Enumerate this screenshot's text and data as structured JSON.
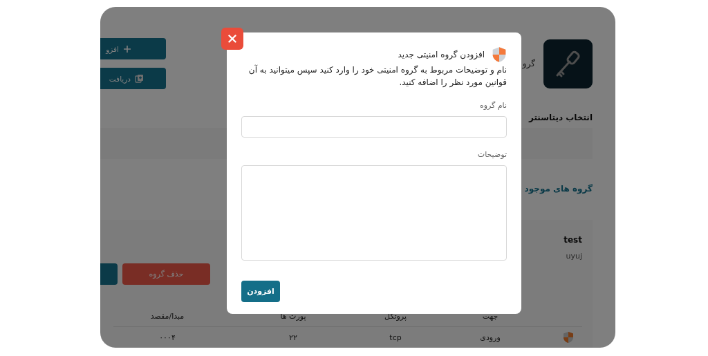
{
  "background": {
    "action_buttons": [
      {
        "kind": "plus",
        "label": "افزو"
      },
      {
        "kind": "copy",
        "label": "دریافت"
      }
    ],
    "card_title": "گرو",
    "datacenter_heading": "انتخاب دیتاسنتر",
    "groups_heading": "گروه های موجود",
    "group": {
      "name": "test",
      "description": "uyuj",
      "buttons": [
        {
          "kind": "danger",
          "label": "حذف گروه"
        },
        {
          "kind": "primary"
        }
      ]
    },
    "table": {
      "columns": [
        "جهت",
        "پروتکل",
        "پورت ها",
        "مبدا/مقصد"
      ],
      "rows": [
        {
          "cells": [
            "ورودی",
            "tcp",
            "۲۲",
            "۰۰۰۴"
          ]
        }
      ]
    }
  },
  "modal": {
    "title": "افزودن گروه امنیتی جدید",
    "description": "نام و توضیحات مربوط به گروه امنیتی خود را وارد کنید سپس میتوانید به آن قوانین مورد نظر را اضافه کنید.",
    "fields": [
      {
        "kind": "input",
        "label": "نام گروه"
      },
      {
        "kind": "textarea",
        "label": "توضیحات"
      }
    ],
    "submit": "افزودن"
  }
}
